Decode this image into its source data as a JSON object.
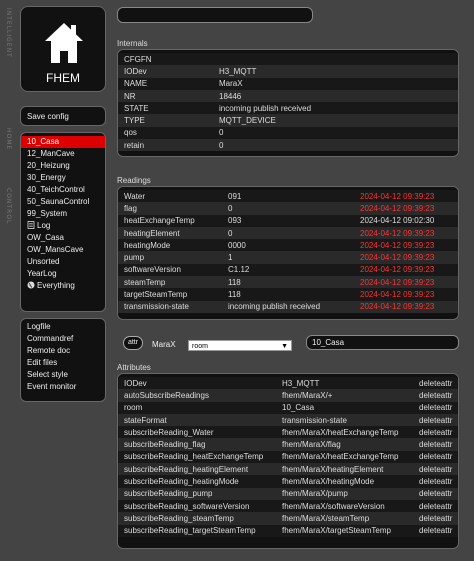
{
  "sidebar_vertical_text": [
    "INTELLIGENT",
    "HOME",
    "CONTROL"
  ],
  "logo": {
    "label": "FHEM"
  },
  "menu": {
    "save": "Save config",
    "rooms": [
      "10_Casa",
      "12_ManCave",
      "20_Heizung",
      "30_Energy",
      "40_TeichControl",
      "50_SaunaControl",
      "99_System",
      "Log",
      "OW_Casa",
      "OW_MansCave",
      "Unsorted",
      "YearLog",
      "Everything"
    ],
    "selected_room": "10_Casa",
    "tools": [
      "Logfile",
      "Commandref",
      "Remote doc",
      "Edit files",
      "Select style",
      "Event monitor"
    ]
  },
  "internals": {
    "title": "Internals",
    "rows": [
      [
        "CFGFN",
        ""
      ],
      [
        "IODev",
        "H3_MQTT"
      ],
      [
        "NAME",
        "MaraX"
      ],
      [
        "NR",
        "18446"
      ],
      [
        "STATE",
        "incoming publish received"
      ],
      [
        "TYPE",
        "MQTT_DEVICE"
      ],
      [
        "qos",
        "0"
      ],
      [
        "retain",
        "0"
      ]
    ]
  },
  "readings": {
    "title": "Readings",
    "rows": [
      [
        "Water",
        "091",
        "2024-04-12 09:39:23",
        true
      ],
      [
        "flag",
        "0",
        "2024-04-12 09:39:23",
        true
      ],
      [
        "heatExchangeTemp",
        "093",
        "2024-04-12 09:02:30",
        false
      ],
      [
        "heatingElement",
        "0",
        "2024-04-12 09:39:23",
        true
      ],
      [
        "heatingMode",
        "0000",
        "2024-04-12 09:39:23",
        true
      ],
      [
        "pump",
        "1",
        "2024-04-12 09:39:23",
        true
      ],
      [
        "softwareVersion",
        "C1.12",
        "2024-04-12 09:39:23",
        true
      ],
      [
        "steamTemp",
        "118",
        "2024-04-12 09:39:23",
        true
      ],
      [
        "targetSteamTemp",
        "118",
        "2024-04-12 09:39:23",
        true
      ],
      [
        "transmission-state",
        "incoming publish received",
        "2024-04-12 09:39:23",
        true
      ]
    ]
  },
  "attr_bar": {
    "button": "attr",
    "device": "MaraX",
    "select_value": "room",
    "input_value": "10_Casa"
  },
  "attributes": {
    "title": "Attributes",
    "delete_label": "deleteattr",
    "rows": [
      [
        "IODev",
        "H3_MQTT"
      ],
      [
        "autoSubscribeReadings",
        "fhem/MaraX/+"
      ],
      [
        "room",
        "10_Casa"
      ],
      [
        "stateFormat",
        "transmission-state"
      ],
      [
        "subscribeReading_Water",
        "fhem/MaraX/heatExchangeTemp"
      ],
      [
        "subscribeReading_flag",
        "fhem/MaraX/flag"
      ],
      [
        "subscribeReading_heatExchangeTemp",
        "fhem/MaraX/heatExchangeTemp"
      ],
      [
        "subscribeReading_heatingElement",
        "fhem/MaraX/heatingElement"
      ],
      [
        "subscribeReading_heatingMode",
        "fhem/MaraX/heatingMode"
      ],
      [
        "subscribeReading_pump",
        "fhem/MaraX/pump"
      ],
      [
        "subscribeReading_softwareVersion",
        "fhem/MaraX/softwareVersion"
      ],
      [
        "subscribeReading_steamTemp",
        "fhem/MaraX/steamTemp"
      ],
      [
        "subscribeReading_targetSteamTemp",
        "fhem/MaraX/targetSteamTemp"
      ]
    ]
  },
  "colors": {
    "accent": "#dd0000",
    "timestamp_red": "#ff3333",
    "panel": "#111111",
    "background": "#444444"
  }
}
